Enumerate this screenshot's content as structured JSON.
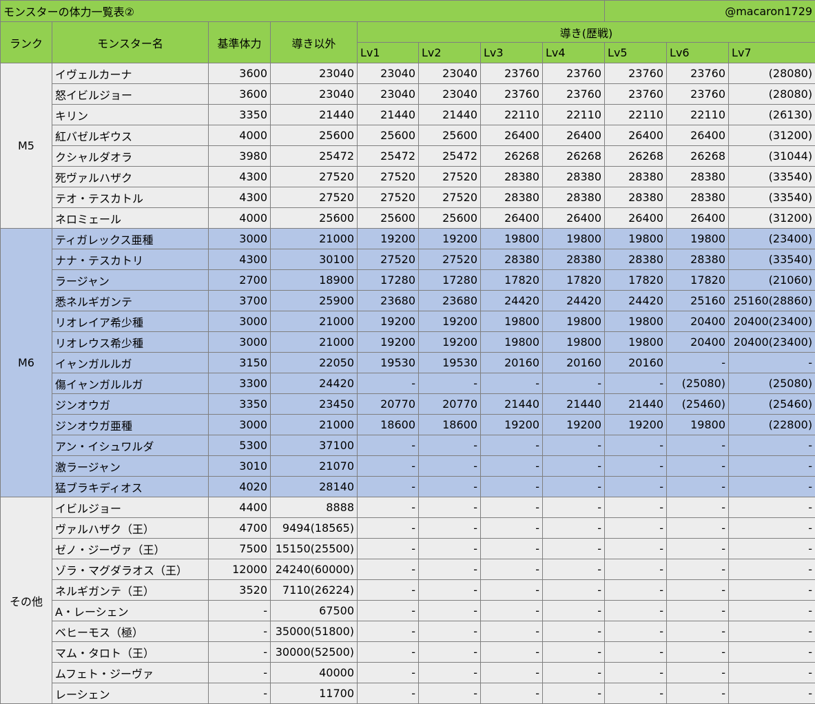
{
  "title": "モンスターの体力一覧表②",
  "handle": "@macaron1729",
  "headers": {
    "rank": "ランク",
    "name": "モンスター名",
    "base_hp": "基準体力",
    "non_guiding": "導き以外",
    "guiding": "導き(歴戦)",
    "levels": [
      "Lv1",
      "Lv2",
      "Lv3",
      "Lv4",
      "Lv5",
      "Lv6",
      "Lv7"
    ]
  },
  "groups": [
    {
      "rank": "M5",
      "band": "gray",
      "rows": [
        {
          "name": "イヴェルカーナ",
          "base": "3600",
          "other": "23040",
          "lv": [
            "23040",
            "23040",
            "23760",
            "23760",
            "23760",
            "23760",
            "(28080)"
          ]
        },
        {
          "name": "怒イビルジョー",
          "base": "3600",
          "other": "23040",
          "lv": [
            "23040",
            "23040",
            "23760",
            "23760",
            "23760",
            "23760",
            "(28080)"
          ]
        },
        {
          "name": "キリン",
          "base": "3350",
          "other": "21440",
          "lv": [
            "21440",
            "21440",
            "22110",
            "22110",
            "22110",
            "22110",
            "(26130)"
          ]
        },
        {
          "name": "紅バゼルギウス",
          "base": "4000",
          "other": "25600",
          "lv": [
            "25600",
            "25600",
            "26400",
            "26400",
            "26400",
            "26400",
            "(31200)"
          ]
        },
        {
          "name": "クシャルダオラ",
          "base": "3980",
          "other": "25472",
          "lv": [
            "25472",
            "25472",
            "26268",
            "26268",
            "26268",
            "26268",
            "(31044)"
          ]
        },
        {
          "name": "死ヴァルハザク",
          "base": "4300",
          "other": "27520",
          "lv": [
            "27520",
            "27520",
            "28380",
            "28380",
            "28380",
            "28380",
            "(33540)"
          ]
        },
        {
          "name": "テオ・テスカトル",
          "base": "4300",
          "other": "27520",
          "lv": [
            "27520",
            "27520",
            "28380",
            "28380",
            "28380",
            "28380",
            "(33540)"
          ]
        },
        {
          "name": "ネロミェール",
          "base": "4000",
          "other": "25600",
          "lv": [
            "25600",
            "25600",
            "26400",
            "26400",
            "26400",
            "26400",
            "(31200)"
          ]
        }
      ]
    },
    {
      "rank": "M6",
      "band": "blue",
      "rows": [
        {
          "name": "ティガレックス亜種",
          "base": "3000",
          "other": "21000",
          "lv": [
            "19200",
            "19200",
            "19800",
            "19800",
            "19800",
            "19800",
            "(23400)"
          ]
        },
        {
          "name": "ナナ・テスカトリ",
          "base": "4300",
          "other": "30100",
          "lv": [
            "27520",
            "27520",
            "28380",
            "28380",
            "28380",
            "28380",
            "(33540)"
          ]
        },
        {
          "name": "ラージャン",
          "base": "2700",
          "other": "18900",
          "lv": [
            "17280",
            "17280",
            "17820",
            "17820",
            "17820",
            "17820",
            "(21060)"
          ]
        },
        {
          "name": "悉ネルギガンテ",
          "base": "3700",
          "other": "25900",
          "lv": [
            "23680",
            "23680",
            "24420",
            "24420",
            "24420",
            "25160",
            "25160(28860)"
          ]
        },
        {
          "name": "リオレイア希少種",
          "base": "3000",
          "other": "21000",
          "lv": [
            "19200",
            "19200",
            "19800",
            "19800",
            "19800",
            "20400",
            "20400(23400)"
          ]
        },
        {
          "name": "リオレウス希少種",
          "base": "3000",
          "other": "21000",
          "lv": [
            "19200",
            "19200",
            "19800",
            "19800",
            "19800",
            "20400",
            "20400(23400)"
          ]
        },
        {
          "name": "イャンガルルガ",
          "base": "3150",
          "other": "22050",
          "lv": [
            "19530",
            "19530",
            "20160",
            "20160",
            "20160",
            "-",
            "-"
          ]
        },
        {
          "name": "傷イャンガルルガ",
          "base": "3300",
          "other": "24420",
          "lv": [
            "-",
            "-",
            "-",
            "-",
            "-",
            "(25080)",
            "(25080)"
          ]
        },
        {
          "name": "ジンオウガ",
          "base": "3350",
          "other": "23450",
          "lv": [
            "20770",
            "20770",
            "21440",
            "21440",
            "21440",
            "(25460)",
            "(25460)"
          ]
        },
        {
          "name": "ジンオウガ亜種",
          "base": "3000",
          "other": "21000",
          "lv": [
            "18600",
            "18600",
            "19200",
            "19200",
            "19200",
            "19800",
            "(22800)"
          ]
        },
        {
          "name": "アン・イシュワルダ",
          "base": "5300",
          "other": "37100",
          "lv": [
            "-",
            "-",
            "-",
            "-",
            "-",
            "-",
            "-"
          ]
        },
        {
          "name": "激ラージャン",
          "base": "3010",
          "other": "21070",
          "lv": [
            "-",
            "-",
            "-",
            "-",
            "-",
            "-",
            "-"
          ]
        },
        {
          "name": "猛ブラキディオス",
          "base": "4020",
          "other": "28140",
          "lv": [
            "-",
            "-",
            "-",
            "-",
            "-",
            "-",
            "-"
          ]
        }
      ]
    },
    {
      "rank": "その他",
      "band": "gray",
      "rows": [
        {
          "name": "イビルジョー",
          "base": "4400",
          "other": "8888",
          "lv": [
            "-",
            "-",
            "-",
            "-",
            "-",
            "-",
            "-"
          ]
        },
        {
          "name": "ヴァルハザク（王）",
          "base": "4700",
          "other": "9494(18565)",
          "lv": [
            "-",
            "-",
            "-",
            "-",
            "-",
            "-",
            "-"
          ]
        },
        {
          "name": "ゼノ・ジーヴァ（王）",
          "base": "7500",
          "other": "15150(25500)",
          "lv": [
            "-",
            "-",
            "-",
            "-",
            "-",
            "-",
            "-"
          ]
        },
        {
          "name": "ゾラ・マグダラオス（王）",
          "base": "12000",
          "other": "24240(60000)",
          "lv": [
            "-",
            "-",
            "-",
            "-",
            "-",
            "-",
            "-"
          ]
        },
        {
          "name": "ネルギガンテ（王）",
          "base": "3520",
          "other": "7110(26224)",
          "lv": [
            "-",
            "-",
            "-",
            "-",
            "-",
            "-",
            "-"
          ]
        },
        {
          "name": "A・レーシェン",
          "base": "-",
          "other": "67500",
          "lv": [
            "-",
            "-",
            "-",
            "-",
            "-",
            "-",
            "-"
          ]
        },
        {
          "name": "ベヒーモス（極）",
          "base": "-",
          "other": "35000(51800)",
          "lv": [
            "-",
            "-",
            "-",
            "-",
            "-",
            "-",
            "-"
          ]
        },
        {
          "name": "マム・タロト（王）",
          "base": "-",
          "other": "30000(52500)",
          "lv": [
            "-",
            "-",
            "-",
            "-",
            "-",
            "-",
            "-"
          ]
        },
        {
          "name": "ムフェト・ジーヴァ",
          "base": "-",
          "other": "40000",
          "lv": [
            "-",
            "-",
            "-",
            "-",
            "-",
            "-",
            "-"
          ]
        },
        {
          "name": "レーシェン",
          "base": "-",
          "other": "11700",
          "lv": [
            "-",
            "-",
            "-",
            "-",
            "-",
            "-",
            "-"
          ]
        }
      ]
    }
  ]
}
